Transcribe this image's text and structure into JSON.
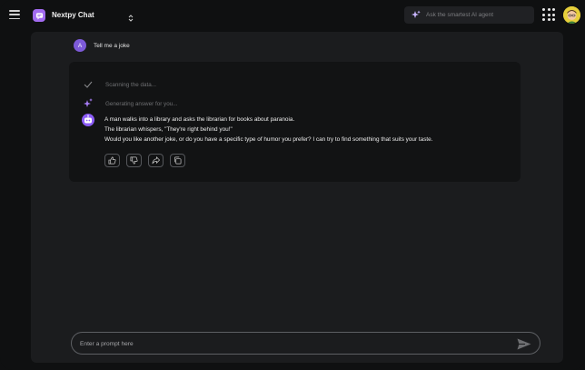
{
  "header": {
    "app_title": "Nextpy Chat",
    "agent_search_placeholder": "Ask the smartest AI agent"
  },
  "icons": {
    "menu": "hamburger-icon",
    "app_logo": "chat-bubble-icon",
    "switcher": "chevron-updown-icon",
    "agent_search": "sparkle-icon",
    "apps": "grid-dots-icon",
    "avatar": "user-avatar-icon",
    "steps": [
      "check-icon",
      "sparkle-icon"
    ],
    "bot": "robot-icon",
    "actions": [
      "thumbs-up-icon",
      "thumbs-down-icon",
      "share-icon",
      "copy-icon"
    ],
    "send": "send-icon"
  },
  "conversation": {
    "user_initial": "A",
    "user_message": "Tell me a joke",
    "steps": [
      {
        "label": "Scanning the data..."
      },
      {
        "label": "Generating answer for you..."
      }
    ],
    "answer_lines": [
      "A man walks into a library and asks the librarian for books about paranoia.",
      "The librarian whispers, \"They're right behind you!\"",
      "Would you like another joke, or do you have a specific type of humor you prefer? I can try to find something that suits your taste."
    ]
  },
  "composer": {
    "placeholder": "Enter a prompt here"
  },
  "colors": {
    "background": "#0f1011",
    "panel": "#1b1c1e",
    "card": "#121314",
    "accent": "#8b5cf6",
    "avatar": "#e6cf3b"
  }
}
